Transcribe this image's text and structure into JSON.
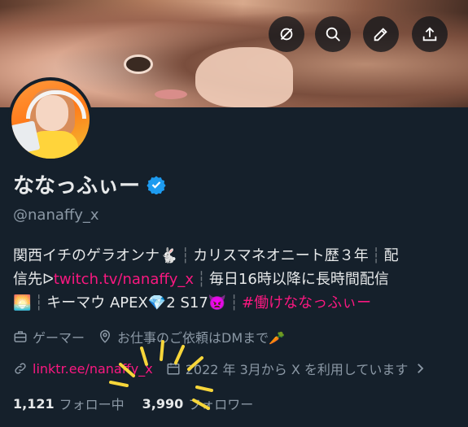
{
  "profile": {
    "name": "ななっふぃー",
    "handle": "@nanaffy_x",
    "bio": {
      "line1_a": "関西イチのゲラオンナ🐇",
      "line1_b": "カリスマネオニート歴３年",
      "line1_c": "配",
      "line2_a": "信先ᐅ",
      "line2_link": "twitch.tv/nanaffy_x",
      "line2_b": "毎日16時以降に長時間配信",
      "line3_a": "🌅",
      "line3_b": "キーマウ APEX💎2 S17👿",
      "line3_tag": "#働けななっふぃー"
    },
    "category": "ゲーマー",
    "location": "お仕事のご依頼はDMまで🥕",
    "website": "linktr.ee/nanaffy_x",
    "joined": "2022 年 3月から X を利用しています",
    "following_count": "1,121",
    "following_label": "フォロー中",
    "followers_count": "3,990",
    "followers_label": "フォロワー"
  },
  "icons": {
    "toolbar": [
      "incognito-icon",
      "search-icon",
      "edit-icon",
      "share-icon"
    ],
    "verified": "verified-badge-icon",
    "category": "briefcase-icon",
    "location": "location-pin-icon",
    "website": "link-icon",
    "joined": "calendar-icon"
  },
  "colors": {
    "background": "#15202b",
    "accent": "#f91880",
    "verified": "#1d9bf0",
    "muted": "#8b98a5"
  }
}
